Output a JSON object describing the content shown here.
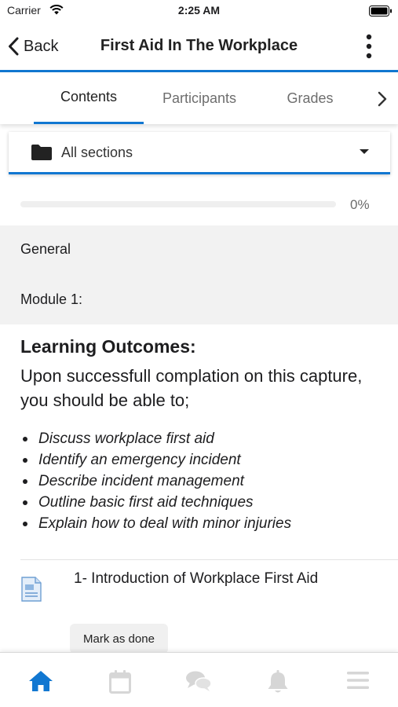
{
  "status_bar": {
    "carrier": "Carrier",
    "time": "2:25 AM"
  },
  "nav": {
    "back_label": "Back",
    "title": "First Aid In The Workplace"
  },
  "tabs": [
    {
      "label": "Contents",
      "active": true
    },
    {
      "label": "Participants",
      "active": false
    },
    {
      "label": "Grades",
      "active": false
    }
  ],
  "section_selector": {
    "label": "All sections",
    "icon": "folder-icon"
  },
  "progress": {
    "percent_label": "0%",
    "value": 0
  },
  "sections": [
    {
      "label": "General"
    },
    {
      "label": "Module 1:"
    }
  ],
  "content": {
    "heading": "Learning Outcomes:",
    "intro": "Upon successfull complation on this capture, you should be able to;",
    "outcomes": [
      "Discuss workplace first aid",
      "Identify an emergency incident",
      "Describe incident management",
      "Outline basic first aid techniques",
      "Explain how to deal with minor injuries"
    ]
  },
  "activity": {
    "title": "1- Introduction of Workplace First Aid",
    "icon": "document-icon",
    "button_label": "Mark as done"
  },
  "tab_bar": {
    "items": [
      {
        "icon": "home-icon",
        "active": true
      },
      {
        "icon": "calendar-icon",
        "active": false
      },
      {
        "icon": "messages-icon",
        "active": false
      },
      {
        "icon": "notifications-icon",
        "active": false
      },
      {
        "icon": "menu-icon",
        "active": false
      }
    ]
  },
  "colors": {
    "accent": "#1177d1",
    "inactive_icon": "#d6d6d6",
    "section_bg": "#f2f2f2"
  }
}
